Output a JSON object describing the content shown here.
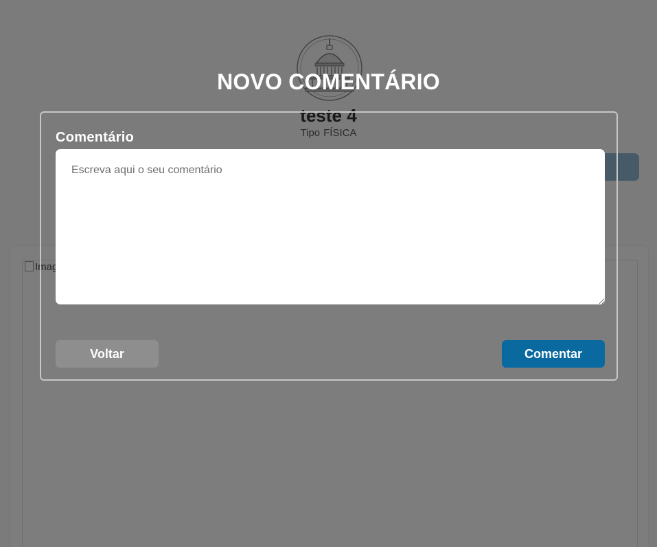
{
  "background": {
    "profile_name": "teste 4",
    "type_label": "Tipo",
    "type_value": "FÍSICA",
    "image_alt": "Imagem"
  },
  "modal": {
    "title": "NOVO COMENTÁRIO",
    "field_label": "Comentário",
    "textarea_placeholder": "Escreva aqui o seu comentário",
    "textarea_value": "",
    "back_label": "Voltar",
    "submit_label": "Comentar"
  },
  "colors": {
    "overlay": "#000000",
    "submit_button": "#0a6aa0",
    "back_button": "#8e8e8e",
    "modal_border": "#c6c6c6"
  },
  "icons": {
    "logo": "capitol-dome-logo",
    "broken_image": "broken-image-icon"
  }
}
